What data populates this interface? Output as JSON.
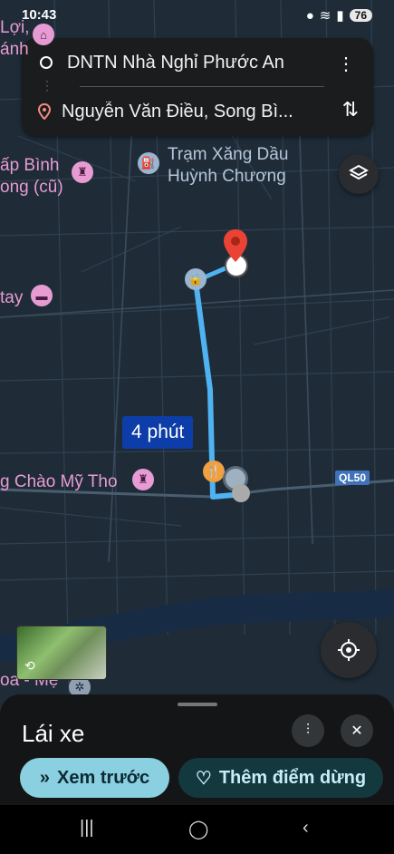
{
  "status": {
    "time": "10:43",
    "battery": "76"
  },
  "search": {
    "origin": "DNTN Nhà Nghỉ Phước An",
    "destination": "Nguyễn Văn Điều, Song Bì...",
    "more_icon": "kebab-icon",
    "swap_icon": "swap-icon"
  },
  "map": {
    "labels": {
      "top_left_1": "Lợi,",
      "top_left_2": "ánh",
      "ap_binh_1": "ấp Bình",
      "ap_binh_2": "ong (cũ)",
      "gas_1": "Trạm Xăng Dầu",
      "gas_2": "Huỳnh Chương",
      "tay": "tay",
      "chao": "g Chào Mỹ Tho",
      "hoa": "oa - Mẹ"
    },
    "route_time": "4 phút",
    "road_shield": "QL50",
    "route_color": "#4fb3f2"
  },
  "sheet": {
    "title": "Lái xe",
    "preview_label": "Xem trước",
    "add_stop_label": "Thêm điểm dừng"
  }
}
